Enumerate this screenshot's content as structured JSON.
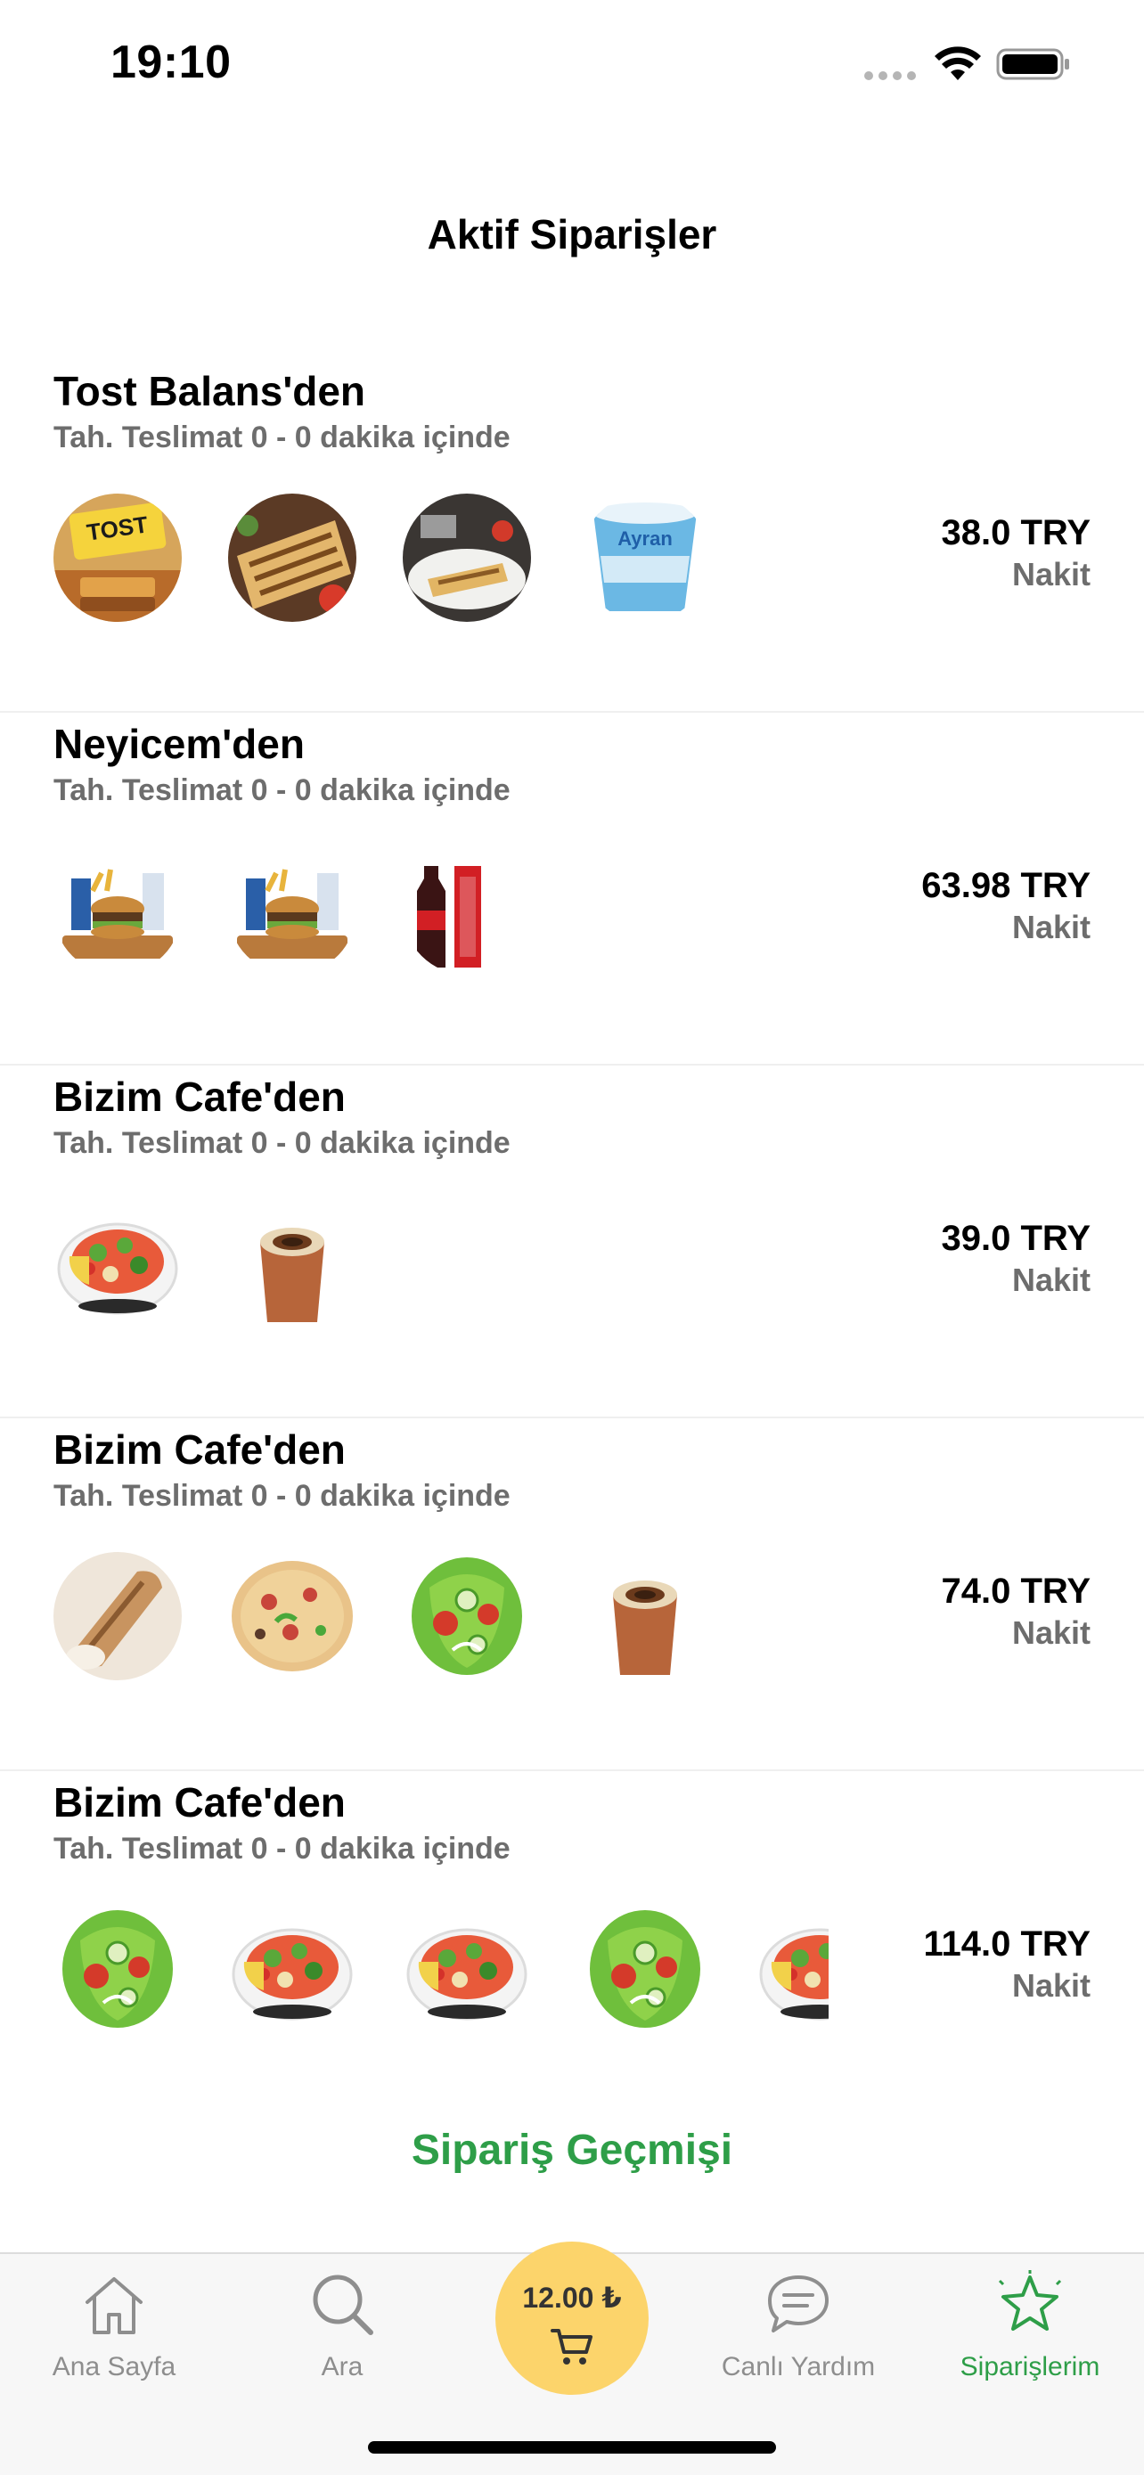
{
  "status_bar": {
    "time": "19:10"
  },
  "header": {
    "title": "Aktif Siparişler"
  },
  "orders": [
    {
      "restaurant": "Tost Balans'den",
      "eta": "Tah. Teslimat 0 - 0 dakika içinde",
      "price": "38.0 TRY",
      "payment": "Nakit",
      "items": [
        "toast-logo",
        "grilled-toast",
        "toast-plate",
        "ayran-cup"
      ]
    },
    {
      "restaurant": "Neyicem'den",
      "eta": "Tah. Teslimat 0 - 0 dakika içinde",
      "price": "63.98 TRY",
      "payment": "Nakit",
      "items": [
        "burger-menu",
        "burger-menu",
        "cola-bottle"
      ]
    },
    {
      "restaurant": "Bizim Cafe'den",
      "eta": "Tah. Teslimat 0 - 0 dakika içinde",
      "price": "39.0 TRY",
      "payment": "Nakit",
      "items": [
        "salad-bowl",
        "rice-pudding"
      ]
    },
    {
      "restaurant": "Bizim Cafe'den",
      "eta": "Tah. Teslimat 0 - 0 dakika içinde",
      "price": "74.0 TRY",
      "payment": "Nakit",
      "items": [
        "wrap",
        "pizza",
        "green-salad",
        "rice-pudding"
      ]
    },
    {
      "restaurant": "Bizim Cafe'den",
      "eta": "Tah. Teslimat 0 - 0 dakika içinde",
      "price": "114.0 TRY",
      "payment": "Nakit",
      "items": [
        "green-salad",
        "salad-bowl",
        "salad-bowl",
        "green-salad",
        "salad-bowl"
      ]
    }
  ],
  "history_link": "Sipariş Geçmişi",
  "tab_bar": {
    "home": "Ana Sayfa",
    "search": "Ara",
    "cart_total": "12.00 ₺",
    "support": "Canlı Yardım",
    "orders": "Siparişlerim"
  },
  "colors": {
    "accent_green": "#2e9e48",
    "cart_yellow": "#fcd46b"
  }
}
